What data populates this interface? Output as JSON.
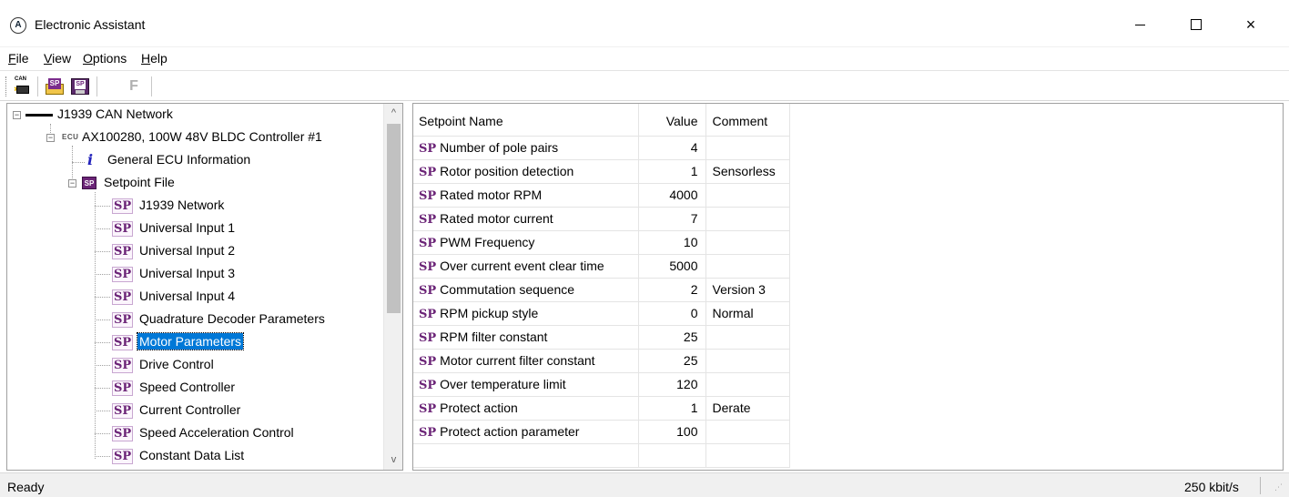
{
  "window": {
    "title": "Electronic Assistant",
    "controls": {
      "minimize": "minimize",
      "maximize": "maximize",
      "close": "×"
    }
  },
  "menu": [
    {
      "label": "File",
      "underline": "F",
      "rest": "ile"
    },
    {
      "label": "View",
      "underline": "V",
      "rest": "iew"
    },
    {
      "label": "Options",
      "underline": "O",
      "rest": "ptions"
    },
    {
      "label": "Help",
      "underline": "H",
      "rest": "elp"
    }
  ],
  "toolbar": {
    "can_icon_text": "CAN",
    "sp_open_icon_text": "SP",
    "sp_save_icon_text": "SP",
    "f_label": "F"
  },
  "tree": {
    "network": "J1939 CAN Network",
    "ecu_tag": "ECU",
    "ecu": "AX100280, 100W 48V BLDC Controller #1",
    "info_icon": "i",
    "general": "General ECU Information",
    "setpoint_file_icon": "SP",
    "setpoint_file": "Setpoint File",
    "sp_tag": "SP",
    "items": [
      "J1939 Network",
      "Universal Input 1",
      "Universal Input 2",
      "Universal Input 3",
      "Universal Input 4",
      "Quadrature Decoder Parameters",
      "Motor Parameters",
      "Drive Control",
      "Speed Controller",
      "Current Controller",
      "Speed Acceleration Control",
      "Constant Data List"
    ],
    "selected_index": 6,
    "scroll_up_glyph": "^",
    "scroll_down_glyph": "v"
  },
  "grid": {
    "headers": [
      "Setpoint Name",
      "Value",
      "Comment"
    ],
    "sp_tag": "SP",
    "rows": [
      {
        "name": "Number of pole pairs",
        "value": "4",
        "comment": ""
      },
      {
        "name": "Rotor position detection",
        "value": "1",
        "comment": "Sensorless"
      },
      {
        "name": "Rated motor RPM",
        "value": "4000",
        "comment": ""
      },
      {
        "name": "Rated motor current",
        "value": "7",
        "comment": ""
      },
      {
        "name": "PWM Frequency",
        "value": "10",
        "comment": ""
      },
      {
        "name": "Over current event clear time",
        "value": "5000",
        "comment": ""
      },
      {
        "name": "Commutation sequence",
        "value": "2",
        "comment": "Version 3"
      },
      {
        "name": "RPM pickup style",
        "value": "0",
        "comment": "Normal"
      },
      {
        "name": "RPM filter constant",
        "value": "25",
        "comment": ""
      },
      {
        "name": "Motor current filter constant",
        "value": "25",
        "comment": ""
      },
      {
        "name": "Over temperature limit",
        "value": "120",
        "comment": ""
      },
      {
        "name": "Protect action",
        "value": "1",
        "comment": "Derate"
      },
      {
        "name": "Protect action parameter",
        "value": "100",
        "comment": ""
      }
    ]
  },
  "status": {
    "text": "Ready",
    "rate": "250 kbit/s"
  }
}
